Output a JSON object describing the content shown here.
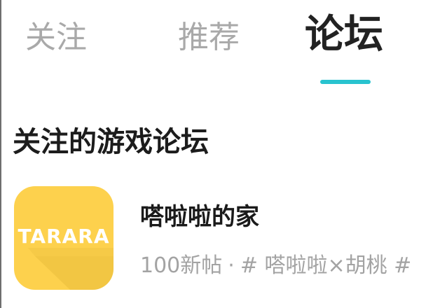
{
  "tabs": [
    {
      "label": "关注",
      "active": false
    },
    {
      "label": "推荐",
      "active": false
    },
    {
      "label": "论坛",
      "active": true
    }
  ],
  "colors": {
    "active_indicator": "#28c3cf",
    "inactive_tab": "#a9a9a9",
    "game_icon_bg": "#fdd14d"
  },
  "section": {
    "title": "关注的游戏论坛"
  },
  "forums": [
    {
      "icon_text": "TARARA",
      "name": "嗒啦啦的家",
      "post_count": "100新帖",
      "separator": "·",
      "tags": "# 嗒啦啦×胡桃 #"
    }
  ]
}
